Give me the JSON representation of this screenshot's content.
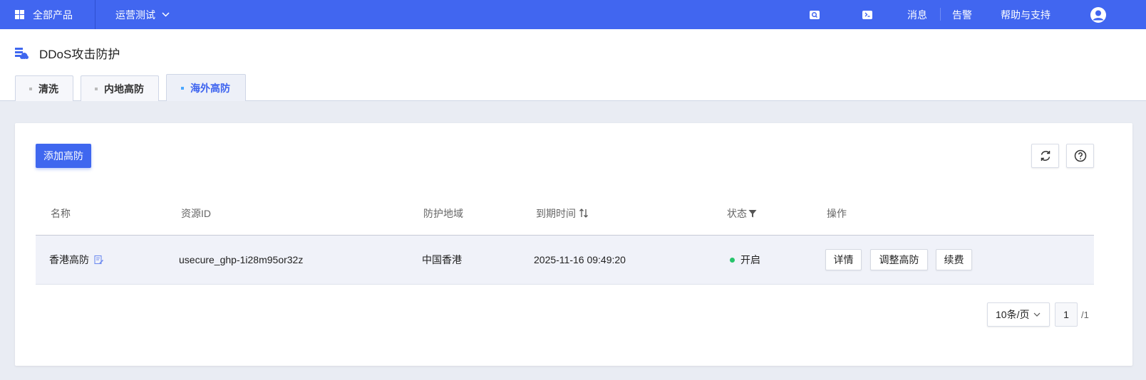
{
  "topbar": {
    "all_products": "全部产品",
    "project": "运营测试",
    "messages": "消息",
    "alerts": "告警",
    "help": "帮助与支持"
  },
  "page": {
    "title": "DDoS攻击防护",
    "tabs": [
      {
        "label": "清洗",
        "active": false
      },
      {
        "label": "内地高防",
        "active": false
      },
      {
        "label": "海外高防",
        "active": true
      }
    ]
  },
  "toolbar": {
    "add_label": "添加高防"
  },
  "table": {
    "columns": [
      "名称",
      "资源ID",
      "防护地域",
      "到期时间",
      "状态",
      "操作"
    ],
    "rows": [
      {
        "name": "香港高防",
        "resource_id": "usecure_ghp-1i28m95or32z",
        "region": "中国香港",
        "expire": "2025-11-16 09:49:20",
        "status": "开启",
        "actions": [
          "详情",
          "调整高防",
          "续费"
        ]
      }
    ]
  },
  "pager": {
    "page_size": "10条/页",
    "current": "1",
    "total": "/1"
  },
  "colors": {
    "brand": "#4166f0",
    "primary_button": "#3f67ef",
    "status_on": "#27c46b",
    "tab_active_text": "#3d63ef"
  }
}
